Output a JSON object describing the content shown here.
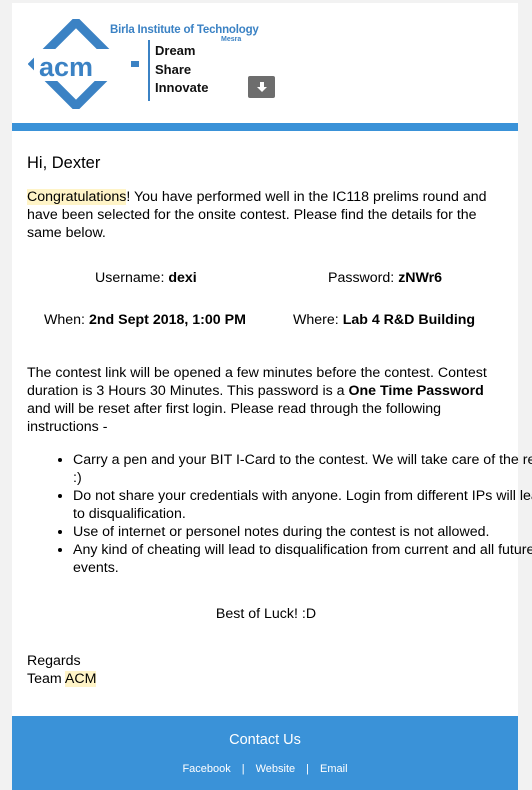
{
  "header": {
    "logo_text": "acm",
    "institute": "Birla Institute of Technology",
    "institute_sub": "Mesra",
    "tagline": [
      "Dream",
      "Share",
      "Innovate"
    ],
    "download_icon": "download-arrow-icon"
  },
  "colors": {
    "accent": "#3a92d8",
    "highlight": "#fff4c7",
    "logo_blue": "#3b82c4"
  },
  "body": {
    "greeting": "Hi, Dexter",
    "congrats_word": "Congratulations",
    "congrats_rest": "! You have performed well in the IC118 prelims round and have been selected for the onsite contest. Please find the details for the same below.",
    "username_label": "Username:",
    "username_value": "dexi",
    "password_label": "Password:",
    "password_value": "zNWr6",
    "when_label": "When:",
    "when_value": "2nd Sept 2018, 1:00 PM",
    "where_label": "Where:",
    "where_value": "Lab 4 R&D Building",
    "info_part1": "The contest link will be opened a few minutes before the contest. Contest duration is 3 Hours 30 Minutes. This password is a ",
    "info_bold": "One Time Password",
    "info_part2": " and will be reset after first login. Please read through the following instructions -",
    "rules": [
      "Carry a pen and your BIT I-Card to the contest. We will take care of the rest. :)",
      "Do not share your credentials with anyone. Login from different IPs will lead to disqualification.",
      "Use of internet or personel notes during the contest is not allowed.",
      "Any kind of cheating will lead to disqualification from current and all future events."
    ],
    "best_luck": "Best of Luck! :D",
    "regards": "Regards",
    "team_prefix": "Team ",
    "team_name": "ACM"
  },
  "footer": {
    "contact_title": "Contact Us",
    "links": [
      "Facebook",
      "Website",
      "Email"
    ],
    "separator": "|"
  }
}
